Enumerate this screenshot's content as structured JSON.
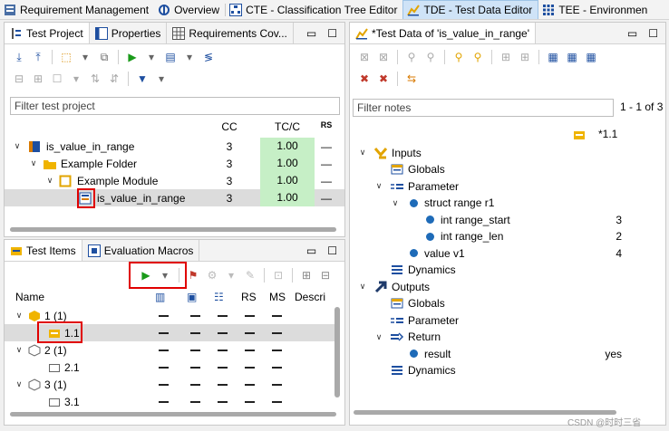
{
  "perspective_tabs": [
    {
      "label": "Requirement Management",
      "icon": "requirements-icon",
      "active": false
    },
    {
      "label": "Overview",
      "icon": "overview-icon",
      "active": false
    },
    {
      "label": "CTE - Classification Tree Editor",
      "icon": "cte-icon",
      "active": false
    },
    {
      "label": "TDE - Test Data Editor",
      "icon": "tde-icon",
      "active": true
    },
    {
      "label": "TEE - Environmen",
      "icon": "tee-icon",
      "active": false
    }
  ],
  "left_top": {
    "tabs": [
      {
        "label": "Test Project",
        "icon": "test-project-icon",
        "active": true
      },
      {
        "label": "Properties",
        "icon": "properties-icon",
        "active": false
      },
      {
        "label": "Requirements Cov...",
        "icon": "requirements-cov-icon",
        "active": false
      }
    ],
    "filter_placeholder": "Filter test project",
    "columns": [
      "CC",
      "TC/C",
      "RS"
    ],
    "rows": [
      {
        "label": "is_value_in_range",
        "cc": "3",
        "tcc": "1.00",
        "rs": "—"
      },
      {
        "label": "Example Folder",
        "cc": "3",
        "tcc": "1.00",
        "rs": "—"
      },
      {
        "label": "Example Module",
        "cc": "3",
        "tcc": "1.00",
        "rs": "—"
      },
      {
        "label": "is_value_in_range",
        "cc": "3",
        "tcc": "1.00",
        "rs": "—"
      }
    ]
  },
  "left_bottom": {
    "tabs": [
      {
        "label": "Test Items",
        "icon": "test-items-icon",
        "active": true
      },
      {
        "label": "Evaluation Macros",
        "icon": "evaluation-macros-icon",
        "active": false
      }
    ],
    "columns": [
      "Name",
      "",
      "",
      "",
      "RS",
      "MS",
      "Descri"
    ],
    "rows": [
      {
        "label": "1 (1)"
      },
      {
        "label": "1.1"
      },
      {
        "label": "2 (1)"
      },
      {
        "label": "2.1"
      },
      {
        "label": "3 (1)"
      },
      {
        "label": "3.1"
      }
    ]
  },
  "right": {
    "tab_label": "*Test Data of 'is_value_in_range'",
    "filter_placeholder": "Filter notes",
    "page_info": "1 - 1 of 3",
    "column_header": "*1.1",
    "rows": [
      {
        "label": "Inputs",
        "value": ""
      },
      {
        "label": "Globals",
        "value": ""
      },
      {
        "label": "Parameter",
        "value": ""
      },
      {
        "label": "struct range r1",
        "value": ""
      },
      {
        "label": "int range_start",
        "value": "3"
      },
      {
        "label": "int range_len",
        "value": "2"
      },
      {
        "label": "value v1",
        "value": "4"
      },
      {
        "label": "Dynamics",
        "value": ""
      },
      {
        "label": "Outputs",
        "value": ""
      },
      {
        "label": "Globals",
        "value": ""
      },
      {
        "label": "Parameter",
        "value": ""
      },
      {
        "label": "Return",
        "value": ""
      },
      {
        "label": "result",
        "value": "yes"
      },
      {
        "label": "Dynamics",
        "value": ""
      }
    ]
  },
  "watermark": "CSDN @时时三省",
  "colors": {
    "accent": "#cfe3f7",
    "green_cell": "#c6efc6",
    "highlight_box": "#e00000"
  }
}
